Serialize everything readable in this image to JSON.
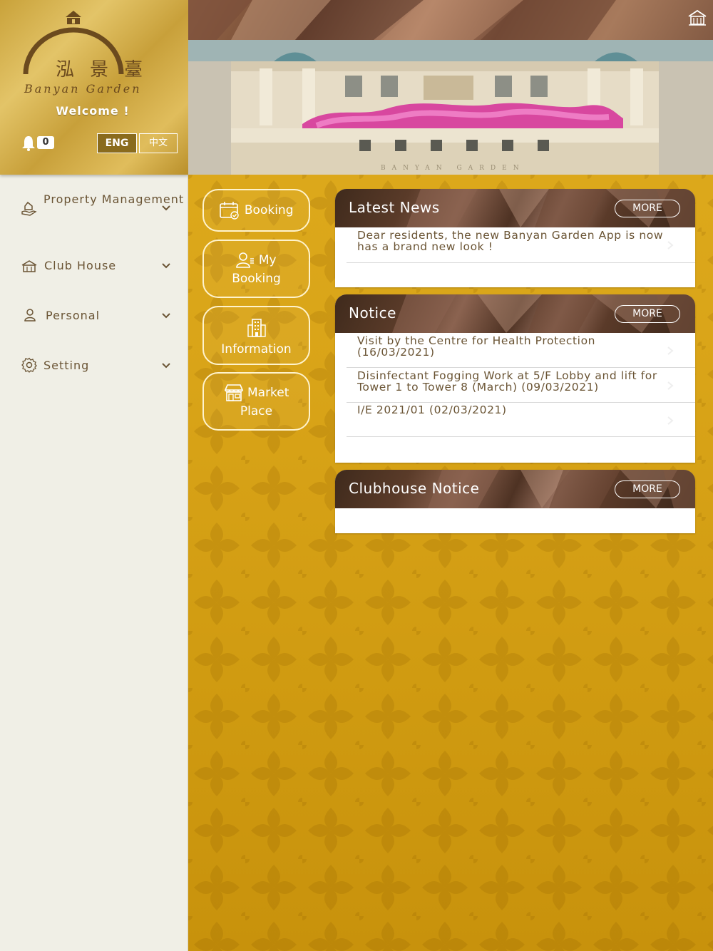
{
  "brand": {
    "logo_chinese": "泓景臺",
    "logo_script": "Banyan Garden",
    "welcome": "Welcome !",
    "notification_count": "0",
    "lang_eng": "ENG",
    "lang_zh": "中文"
  },
  "menu": [
    {
      "label": "Property Management",
      "icon": "hand-house-icon"
    },
    {
      "label": "Club House",
      "icon": "clubhouse-icon"
    },
    {
      "label": "Personal",
      "icon": "person-icon"
    },
    {
      "label": "Setting",
      "icon": "gear-icon"
    }
  ],
  "quick": {
    "booking": "Booking",
    "my_booking_1": "My",
    "my_booking_2": "Booking",
    "information": "Information",
    "market_1": "Market",
    "market_2": "Place"
  },
  "hero": {
    "sign_text": "BANYAN GARDEN"
  },
  "panels": {
    "latest_news": {
      "title": "Latest News",
      "more": "MORE",
      "items": [
        "Dear residents, the new Banyan Garden App is now has a brand new look !"
      ]
    },
    "notice": {
      "title": "Notice",
      "more": "MORE",
      "items": [
        "Visit by the Centre for Health Protection (16/03/2021)",
        "Disinfectant Fogging Work at 5/F Lobby and lift for Tower 1 to Tower 8 (March) (09/03/2021)",
        "I/E 2021/01 (02/03/2021)"
      ]
    },
    "clubhouse_notice": {
      "title": "Clubhouse Notice",
      "more": "MORE"
    }
  },
  "colors": {
    "gold": "#d9a418",
    "brown": "#6a5434",
    "dark_brown": "#4e3223",
    "sidebar_bg": "#f0efe6"
  }
}
